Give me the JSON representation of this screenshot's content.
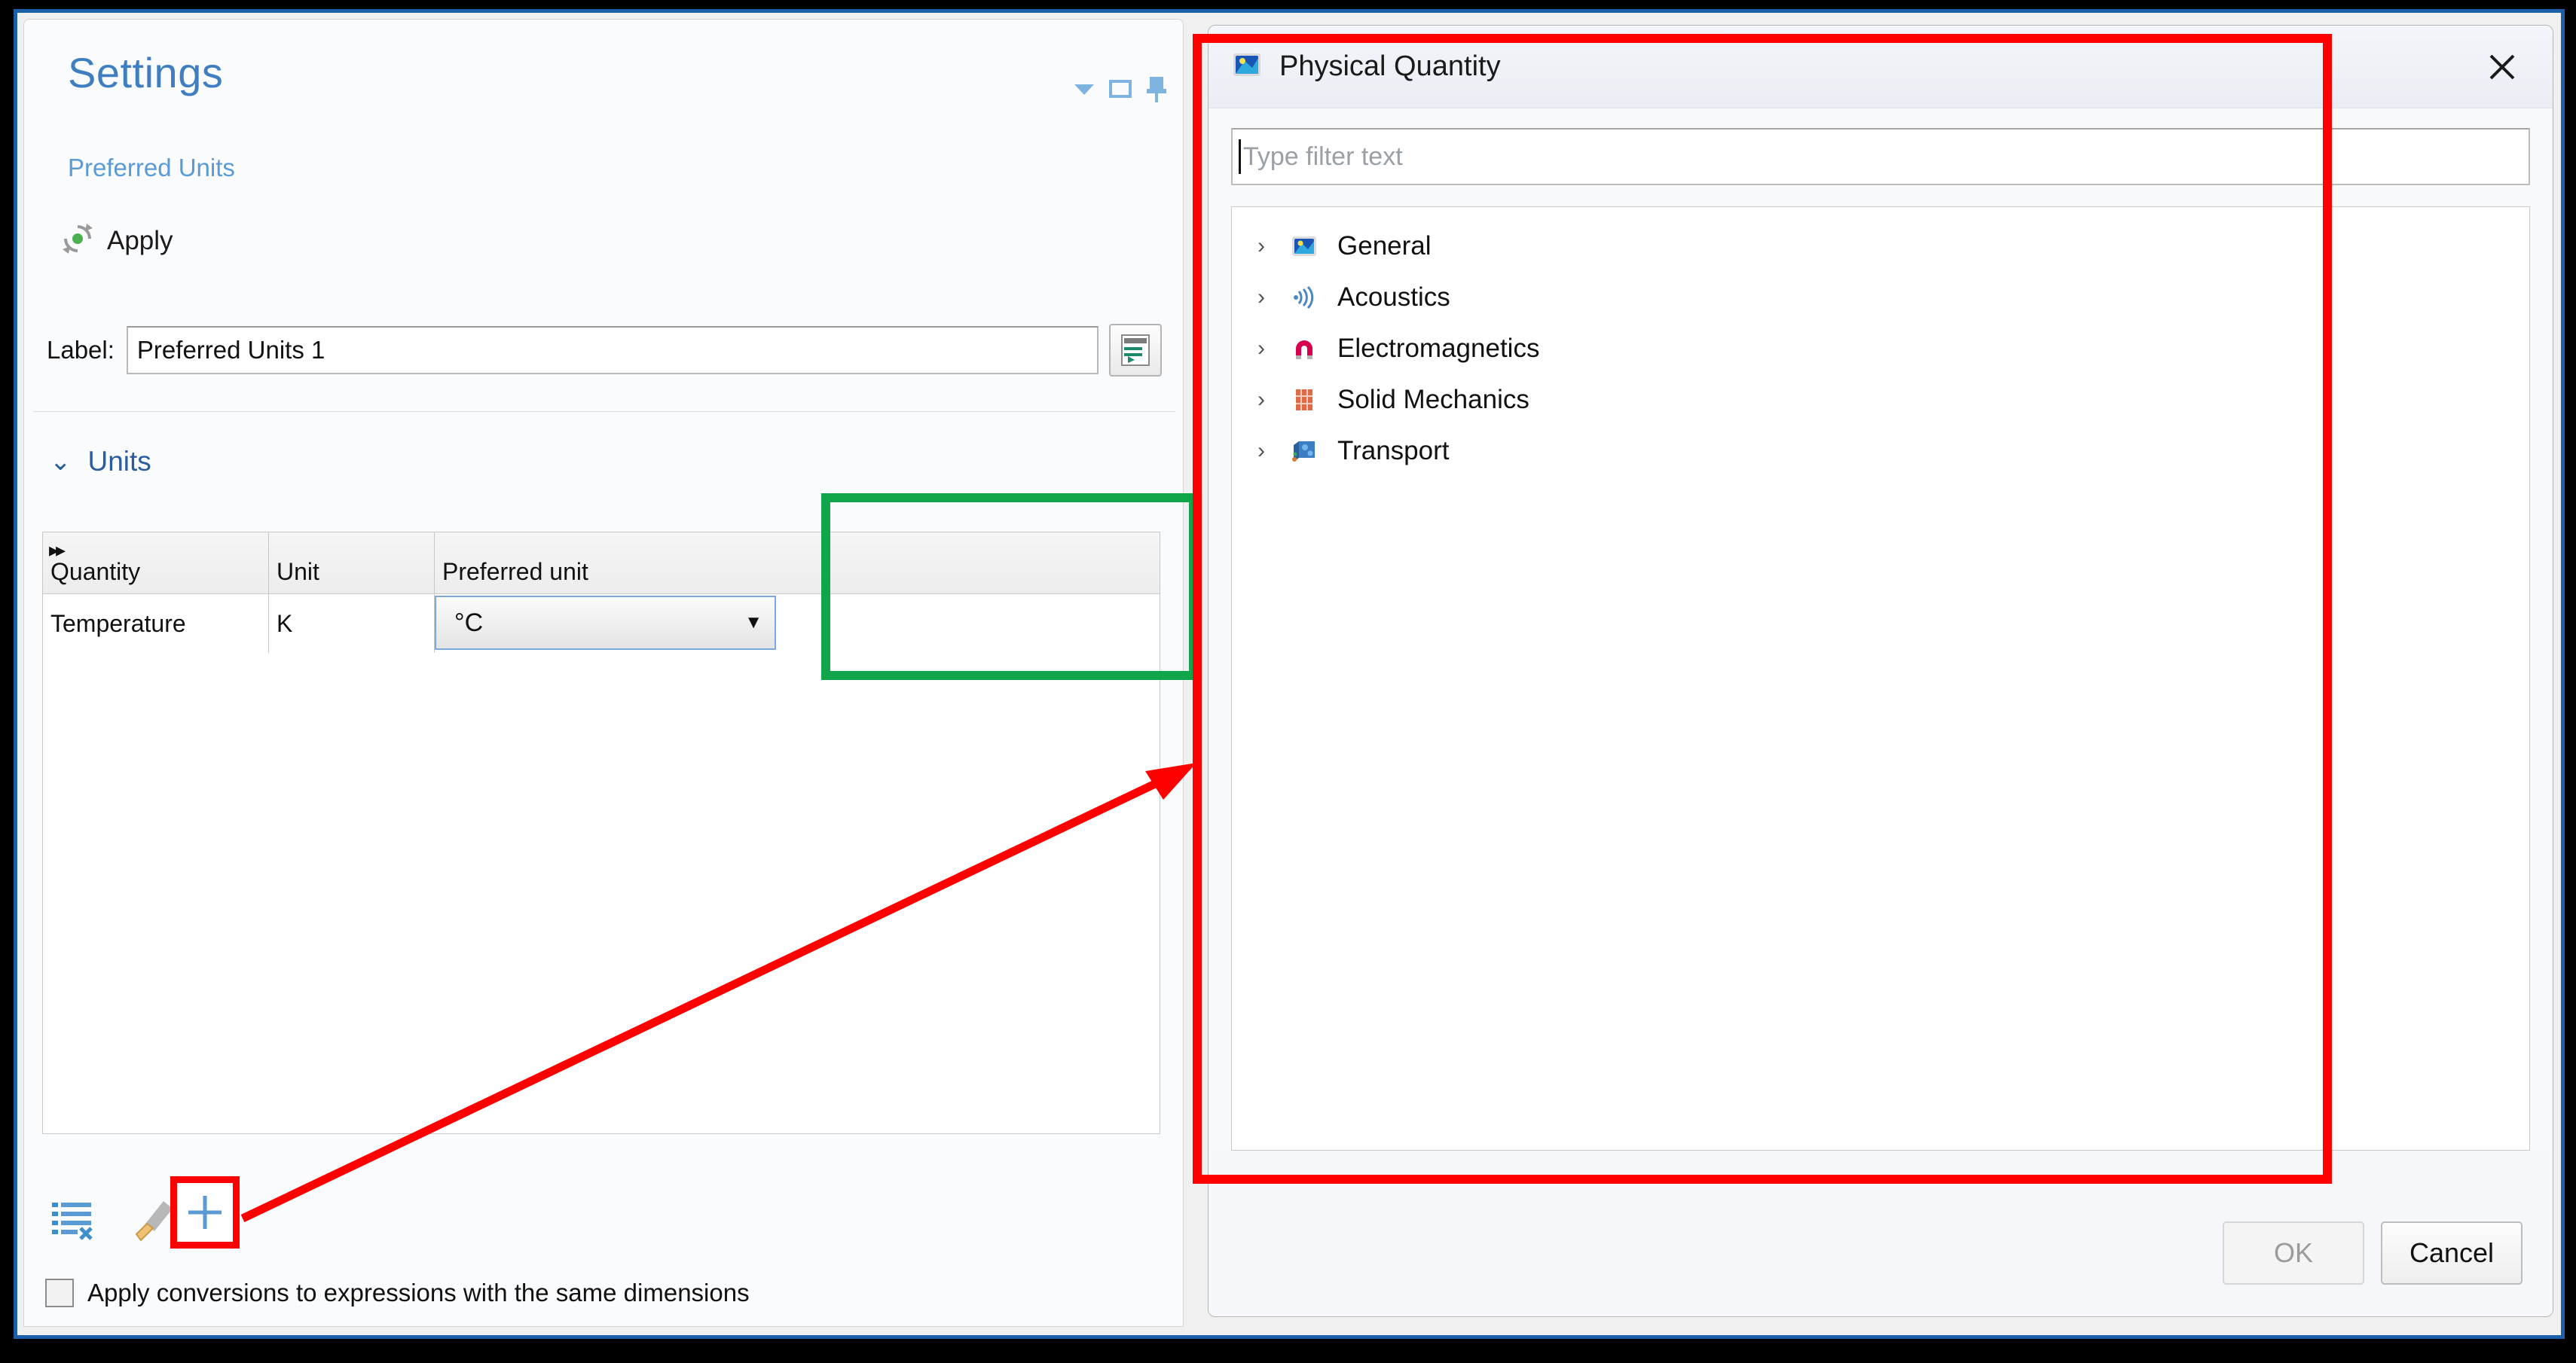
{
  "settings_panel": {
    "title": "Settings",
    "subtitle": "Preferred Units",
    "apply_label": "Apply",
    "header_icons": [
      {
        "name": "dropdown-menu-icon",
        "glyph": "▼"
      },
      {
        "name": "maximize-icon",
        "glyph": "▭"
      },
      {
        "name": "pin-icon",
        "glyph": "📌"
      }
    ],
    "label_field": {
      "label": "Label:",
      "value": "Preferred Units 1",
      "placeholder": "",
      "button_name": "rename-label-button"
    },
    "units_section": {
      "header": "Units",
      "expanded": true,
      "columns": [
        "Quantity",
        "Unit",
        "Preferred unit"
      ],
      "rows": [
        {
          "quantity": "Temperature",
          "unit": "K",
          "preferred_unit": "°C"
        }
      ],
      "toolbar": [
        {
          "name": "clear-table-button",
          "glyph": "list-clear-icon"
        },
        {
          "name": "clear-all-button",
          "glyph": "broom-icon"
        },
        {
          "name": "add-quantity-button",
          "glyph": "+"
        }
      ]
    },
    "checkbox": {
      "label": "Apply conversions to expressions with the same dimensions",
      "checked": false
    }
  },
  "dialog": {
    "title": "Physical Quantity",
    "icon_name": "physical-quantity-icon",
    "close_label": "✕",
    "filter": {
      "value": "",
      "placeholder": "Type filter text"
    },
    "tree_items": [
      {
        "label": "General",
        "icon": "general-icon",
        "expanded": false,
        "arrow": "›"
      },
      {
        "label": "Acoustics",
        "icon": "acoustics-icon",
        "expanded": false,
        "arrow": "›"
      },
      {
        "label": "Electromagnetics",
        "icon": "electromagnetics-icon",
        "expanded": false,
        "arrow": "›"
      },
      {
        "label": "Solid Mechanics",
        "icon": "solid-mechanics-icon",
        "expanded": false,
        "arrow": "›"
      },
      {
        "label": "Transport",
        "icon": "transport-icon",
        "expanded": false,
        "arrow": "›"
      }
    ],
    "buttons": {
      "ok_label": "OK",
      "ok_enabled": false,
      "cancel_label": "Cancel"
    }
  },
  "annotations": {
    "red_color": "#fe0000",
    "green_color": "#10a54a",
    "red_box_target": "physical-quantity-dialog",
    "green_box_target": "preferred-unit-column",
    "plus_box_target": "add-quantity-button",
    "arrow_from": "add-quantity-button",
    "arrow_to": "physical-quantity-dialog"
  }
}
